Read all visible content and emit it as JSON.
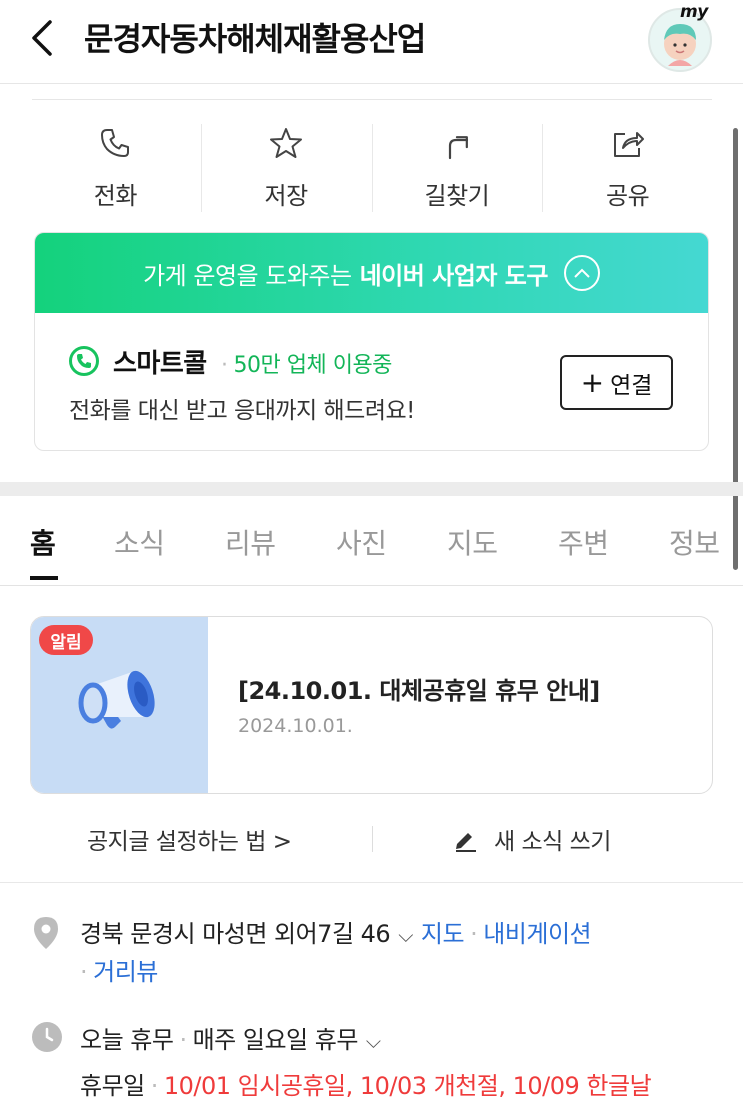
{
  "header": {
    "title": "문경자동차해체재활용산업",
    "avatar_badge": "my"
  },
  "actions": [
    {
      "label": "전화",
      "icon": "phone-icon"
    },
    {
      "label": "저장",
      "icon": "star-icon"
    },
    {
      "label": "길찾기",
      "icon": "directions-icon"
    },
    {
      "label": "공유",
      "icon": "share-icon"
    }
  ],
  "business_tool": {
    "banner_prefix": "가게 운영을 도와주는",
    "banner_strong": "네이버 사업자 도구",
    "smartcall_name": "스마트콜",
    "smartcall_users": "50만 업체 이용중",
    "smartcall_desc": "전화를 대신 받고 응대까지 해드려요!",
    "connect_label": "연결",
    "brand_color": "#14d27c"
  },
  "tabs": [
    "홈",
    "소식",
    "리뷰",
    "사진",
    "지도",
    "주변",
    "정보"
  ],
  "notice": {
    "badge": "알림",
    "title": "[24.10.01. 대체공휴일 휴무 안내]",
    "date": "2024.10.01.",
    "howto_link": "공지글 설정하는 법 >",
    "write_link": "새 소식 쓰기"
  },
  "info": {
    "address": "경북 문경시 마성면 외어7길 46",
    "map_link": "지도",
    "navigation_link": "내비게이션",
    "roadview_link": "거리뷰",
    "today_status": "오늘 휴무",
    "regular_closing": "매주 일요일 휴무",
    "holiday_label": "휴무일",
    "holiday_dates": "10/01 임시공휴일, 10/03 개천절, 10/09 한글날",
    "link_color": "#2b6fd6",
    "holiday_color": "#ef3b3b"
  }
}
